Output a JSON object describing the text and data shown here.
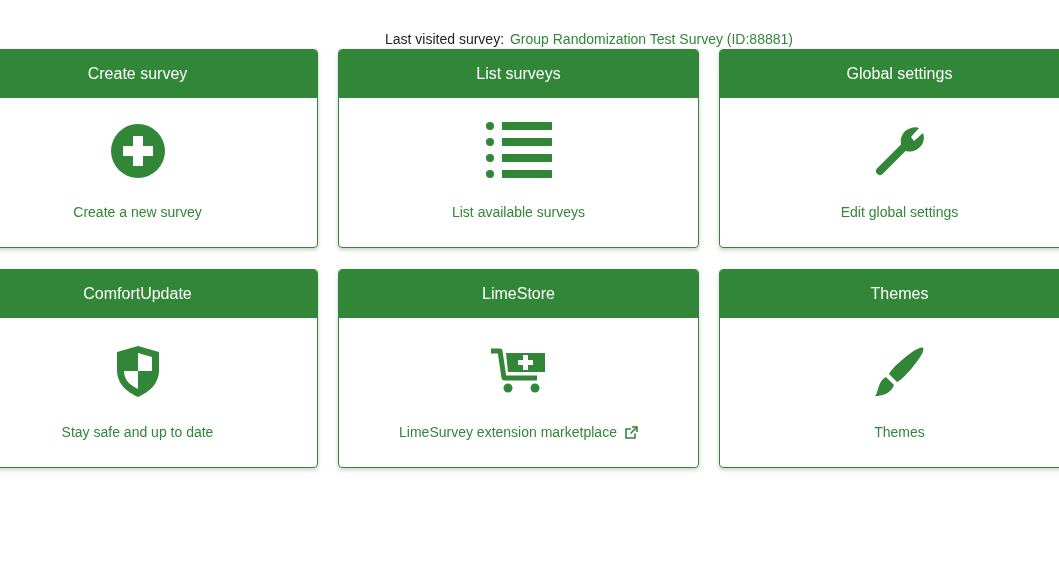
{
  "last_visited": {
    "label": "Last visited survey:",
    "link": "Group Randomization Test Survey (ID:88881)"
  },
  "cards": [
    {
      "title": "Create survey",
      "kind": "plus-circle",
      "description": "Create a new survey",
      "external": false
    },
    {
      "title": "List surveys",
      "kind": "list",
      "description": "List available surveys",
      "external": false
    },
    {
      "title": "Global settings",
      "kind": "wrench",
      "description": "Edit global settings",
      "external": false
    },
    {
      "title": "ComfortUpdate",
      "kind": "shield",
      "description": "Stay safe and up to date",
      "external": false
    },
    {
      "title": "LimeStore",
      "kind": "cart",
      "description": "LimeSurvey extension marketplace",
      "external": true
    },
    {
      "title": "Themes",
      "kind": "brush",
      "description": "Themes",
      "external": false
    }
  ]
}
